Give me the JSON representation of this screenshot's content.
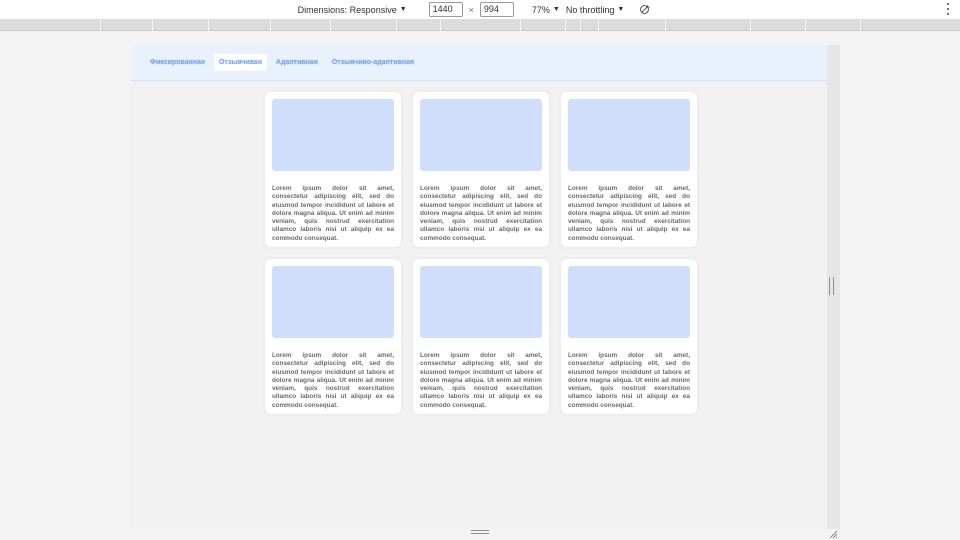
{
  "toolbar": {
    "dimensions_label": "Dimensions: Responsive",
    "width_value": "1440",
    "times": "×",
    "height_value": "994",
    "zoom_label": "77%",
    "throttling_label": "No throttling",
    "caret": "▼"
  },
  "page": {
    "nav_tabs": [
      {
        "label": "Фиксированная"
      },
      {
        "label": "Отзывчивая"
      },
      {
        "label": "Адаптивная"
      },
      {
        "label": "Отзывчиво-адаптивная"
      }
    ],
    "active_tab_index": 1,
    "cards": [
      {
        "text": "Lorem ipsum dolor sit amet, consectetur adipiscing elit, sed do eiusmod tempor incididunt ut labore et dolore magna aliqua. Ut enim ad minim veniam, quis nostrud exercitation ullamco laboris nisi ut aliquip ex ea commodo consequat."
      },
      {
        "text": "Lorem ipsum dolor sit amet, consectetur adipiscing elit, sed do eiusmod tempor incididunt ut labore et dolore magna aliqua. Ut enim ad minim veniam, quis nostrud exercitation ullamco laboris nisi ut aliquip ex ea commodo consequat."
      },
      {
        "text": "Lorem ipsum dolor sit amet, consectetur adipiscing elit, sed do eiusmod tempor incididunt ut labore et dolore magna aliqua. Ut enim ad minim veniam, quis nostrud exercitation ullamco laboris nisi ut aliquip ex ea commodo consequat."
      },
      {
        "text": "Lorem ipsum dolor sit amet, consectetur adipiscing elit, sed do eiusmod tempor incididunt ut labore et dolore magna aliqua. Ut enim ad minim veniam, quis nostrud exercitation ullamco laboris nisi ut aliquip ex ea commodo consequat."
      },
      {
        "text": "Lorem ipsum dolor sit amet, consectetur adipiscing elit, sed do eiusmod tempor incididunt ut labore et dolore magna aliqua. Ut enim ad minim veniam, quis nostrud exercitation ullamco laboris nisi ut aliquip ex ea commodo consequat."
      },
      {
        "text": "Lorem ipsum dolor sit amet, consectetur adipiscing elit, sed do eiusmod tempor incididunt ut labore et dolore magna aliqua. Ut enim ad minim veniam, quis nostrud exercitation ullamco laboris nisi ut aliquip ex ea commodo consequat."
      }
    ]
  },
  "colors": {
    "nav_background": "#e9f1fd",
    "nav_text": "#7aa5e8",
    "image_placeholder": "#cfdffb",
    "card_background": "#ffffff"
  },
  "icons": {
    "rotate": "rotate-icon",
    "more": "more-vert-icon"
  }
}
